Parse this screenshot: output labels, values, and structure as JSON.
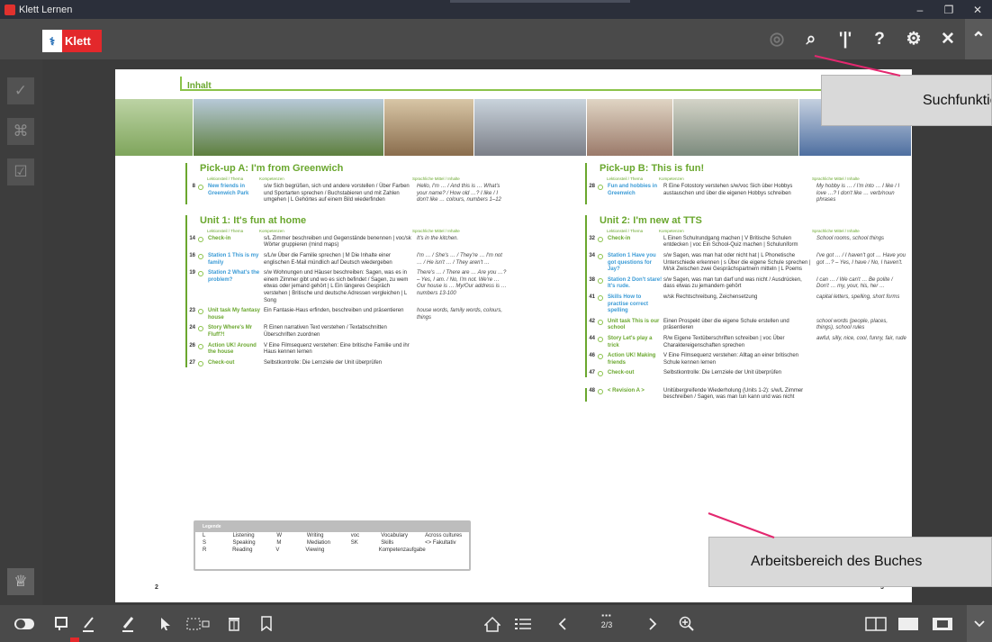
{
  "window": {
    "title": "Klett Lernen",
    "controls": [
      "–",
      "❐",
      "✕"
    ]
  },
  "toolbar": {
    "brand": "Klett",
    "brand_mark": "⚕",
    "icons": [
      {
        "name": "globe-icon",
        "glyph": "◎",
        "dim": true
      },
      {
        "name": "search-icon",
        "glyph": "⌕"
      },
      {
        "name": "bookmark-ribbon-icon",
        "glyph": "'|'"
      },
      {
        "name": "help-icon",
        "glyph": "?"
      },
      {
        "name": "settings-icon",
        "glyph": "⚙"
      },
      {
        "name": "close-icon",
        "glyph": "✕"
      },
      {
        "name": "collapse-up-icon",
        "glyph": "⌃"
      }
    ]
  },
  "rail": {
    "items": [
      {
        "name": "rail-check-icon",
        "glyph": "✓"
      },
      {
        "name": "rail-puzzle-icon",
        "glyph": "⌘"
      },
      {
        "name": "rail-task-icon",
        "glyph": "☑"
      }
    ],
    "user_glyph": "♕"
  },
  "book": {
    "section_label": "Inhalt",
    "page_left": "2",
    "page_right": "3",
    "left": [
      {
        "title": "Pick-up A: I'm from Greenwich",
        "headers": [
          "Lektionsteil / Thema",
          "Kompetenzen",
          "Sprachliche Mittel / Inhalte"
        ],
        "rows": [
          {
            "page": "8",
            "theme": "New friends in Greenwich Park",
            "komp": "s/w Sich begrüßen, sich und andere vorstellen / Über Farben und Sportarten sprechen / Buchstabieren und mit Zahlen umgehen | L Gehörtes auf einem Bild wiederfinden",
            "mittel": "Hello, I'm … / And this is … What's your name? / How old …? I like / I don't like … colours, numbers 1–12"
          }
        ]
      },
      {
        "title": "Unit 1: It's fun at home",
        "headers": [
          "Lektionsteil / Thema",
          "Kompetenzen",
          "Sprachliche Mittel / Inhalte"
        ],
        "rows": [
          {
            "page": "14",
            "theme": "Check-in",
            "komp": "s/L Zimmer beschreiben und Gegenstände benennen | voc/sk Wörter gruppieren (mind maps)",
            "mittel": "It's in the kitchen."
          },
          {
            "page": "16",
            "theme": "Station 1 This is my family",
            "komp": "s/L/w Über die Familie sprechen | M Die Inhalte einer englischen E-Mail mündlich auf Deutsch wiedergeben",
            "mittel": "I'm … / She's … / They're … I'm not … / He isn't … / They aren't …"
          },
          {
            "page": "19",
            "theme": "Station 2 What's the problem?",
            "komp": "s/w Wohnungen und Häuser beschreiben: Sagen, was es in einem Zimmer gibt und wo es sich befindet / Sagen, zu wem etwas oder jemand gehört | L Ein längeres Gespräch verstehen | Britische und deutsche Adressen vergleichen | L Song",
            "mittel": "There's … / There are … Are you …? – Yes, I am. / No, I'm not. We're … Our house is … My/Our address is … numbers 13-100"
          },
          {
            "page": "23",
            "theme": "Unit task My fantasy house",
            "komp": "Ein Fantasie-Haus erfinden, beschreiben und präsentieren",
            "mittel": "house words, family words, colours, things"
          },
          {
            "page": "24",
            "theme": "Story Where's Mr Fluff?!",
            "komp": "R Einen narrativen Text verstehen / Textabschnitten Überschriften zuordnen",
            "mittel": ""
          },
          {
            "page": "26",
            "theme": "Action UK! Around the house",
            "komp": "V Eine Filmsequenz verstehen: Eine britische Familie und ihr Haus kennen lernen",
            "mittel": ""
          },
          {
            "page": "27",
            "theme": "Check-out",
            "komp": "Selbstkontrolle: Die Lernziele der Unit überprüfen",
            "mittel": ""
          }
        ]
      }
    ],
    "right": [
      {
        "title": "Pick-up B: This is fun!",
        "headers": [
          "Lektionsteil / Thema",
          "Kompetenzen",
          "Sprachliche Mittel / Inhalte"
        ],
        "rows": [
          {
            "page": "28",
            "theme": "Fun and hobbies in Greenwich",
            "komp": "R Eine Fotostory verstehen s/w/voc Sich über Hobbys austauschen und über die eigenen Hobbys schreiben",
            "mittel": "My hobby is … / I'm into … I like / I love …? I don't like … verb/noun phrases"
          }
        ]
      },
      {
        "title": "Unit 2: I'm new at TTS",
        "headers": [
          "Lektionsteil / Thema",
          "Kompetenzen",
          "Sprachliche Mittel / Inhalte"
        ],
        "rows": [
          {
            "page": "32",
            "theme": "Check-in",
            "komp": "L Einen Schulrundgang machen | V Britische Schulen entdecken | voc Ein School-Quiz machen | Schuluniform",
            "mittel": "School rooms, school things"
          },
          {
            "page": "34",
            "theme": "Station 1 Have you got questions for Jay?",
            "komp": "s/w Sagen, was man hat oder nicht hat | L Phonetische Unterschiede erkennen | s Über die eigene Schule sprechen | M/sk Zwischen zwei Gesprächspartnern mitteln | L Poems",
            "mittel": "I've got … / I haven't got … Have you got …? – Yes, I have / No, I haven't."
          },
          {
            "page": "38",
            "theme": "Station 2 Don't stare! It's rude.",
            "komp": "s/w Sagen, was man tun darf und was nicht / Ausdrücken, dass etwas zu jemandem gehört",
            "mittel": "I can … / We can't … Be polite / Don't … my, your, his, her …"
          },
          {
            "page": "41",
            "theme": "Skills How to practise correct spelling",
            "komp": "w/sk Rechtschreibung, Zeichensetzung",
            "mittel": "capital letters, spelling, short forms"
          },
          {
            "page": "42",
            "theme": "Unit task This is our school",
            "komp": "Einen Prospekt über die eigene Schule erstellen und präsentieren",
            "mittel": "school words (people, places, things), school rules"
          },
          {
            "page": "44",
            "theme": "Story Let's play a trick",
            "komp": "R/w Eigene Textüberschriften schreiben | voc Über Charaktereigenschaften sprechen",
            "mittel": "awful, silly, nice, cool, funny, fair, rude"
          },
          {
            "page": "46",
            "theme": "Action UK! Making friends",
            "komp": "V Eine Filmsequenz verstehen: Alltag an einer britischen Schule kennen lernen",
            "mittel": ""
          },
          {
            "page": "47",
            "theme": "Check-out",
            "komp": "Selbstkontrolle: Die Lernziele der Unit überprüfen",
            "mittel": ""
          }
        ]
      },
      {
        "title": "",
        "headers": [],
        "rows": [
          {
            "page": "48",
            "theme": "< Revision A >",
            "komp": "Unitübergreifende Wiederholung (Units 1-2): s/w/L Zimmer beschreiben / Sagen, was man tun kann und was nicht",
            "mittel": ""
          }
        ]
      }
    ],
    "legend": {
      "title": "Legende",
      "rows": [
        [
          "L",
          "Listening",
          "W",
          "Writing",
          "voc",
          "Vocabulary",
          "Across cultures"
        ],
        [
          "S",
          "Speaking",
          "M",
          "Mediation",
          "SK",
          "Skills",
          "<> Fakultativ"
        ],
        [
          "R",
          "Reading",
          "V",
          "Viewing",
          "",
          "Kompetenzaufgabe",
          ""
        ]
      ]
    }
  },
  "callouts": {
    "search": "Suchfunktion",
    "workspace": "Arbeitsbereich des Buches"
  },
  "bottombar": {
    "page_indicator": "2/3",
    "grid_glyph": "▪▪▪"
  },
  "colors": {
    "accent_green": "#6aa72e",
    "callout_line": "#e3286f",
    "brand_red": "#e3282b"
  }
}
